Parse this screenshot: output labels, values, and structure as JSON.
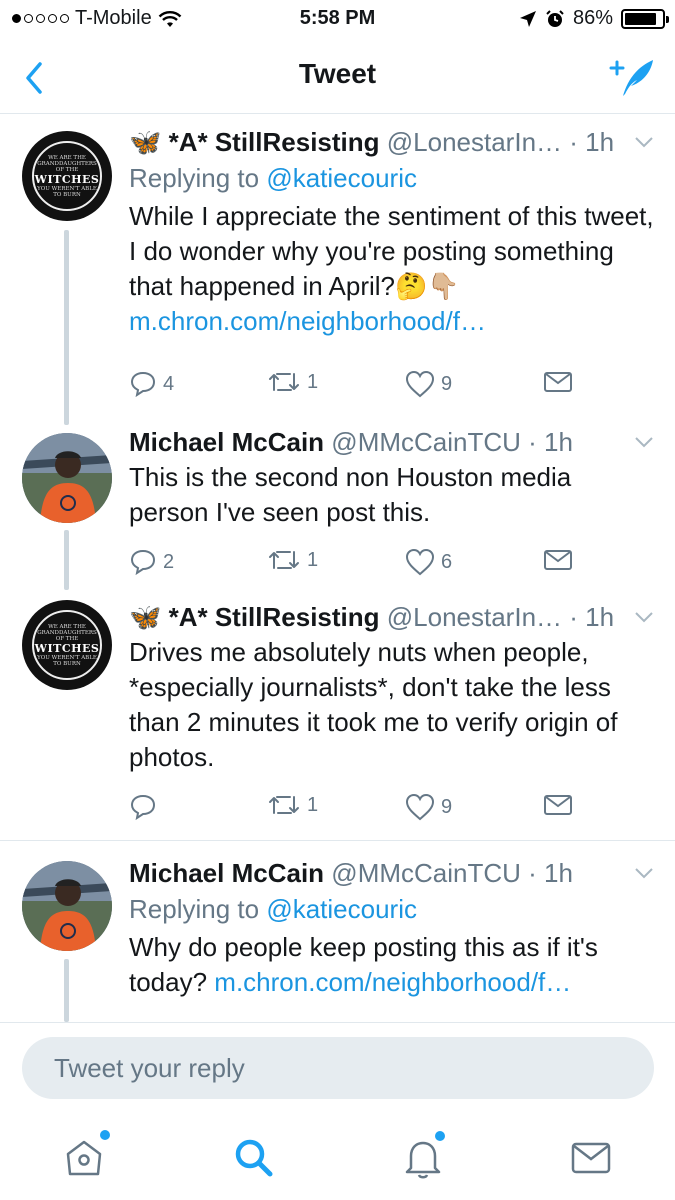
{
  "status_bar": {
    "carrier": "T-Mobile",
    "time": "5:58 PM",
    "battery": "86%",
    "battery_level": 0.86,
    "signal_bars_filled": 1,
    "signal_bars_total": 5
  },
  "nav": {
    "title": "Tweet",
    "back_icon": "chevron-left-icon",
    "compose_icon": "compose-tweet-icon",
    "accent_color": "#1da1f2"
  },
  "tweets": [
    {
      "name": "🦋 *A* StillResisting",
      "handle": "@LonestarIn…",
      "time": "· 1h",
      "replying_prefix": "Replying to ",
      "replying_to": "@katiecouric",
      "text": "While I appreciate the sentiment of this tweet, I do wonder why you're posting something that happened in April?🤔👇🏼",
      "link": "m.chron.com/neighborhood/f…",
      "replies": "4",
      "retweets": "1",
      "likes": "9",
      "avatar_lines": [
        "WE ARE THE",
        "GRANDDAUGHTERS",
        "OF THE",
        "WITCHES",
        "YOU WEREN'T ABLE",
        "TO BURN"
      ]
    },
    {
      "name": "Michael McCain",
      "handle": "@MMcCainTCU",
      "time": "· 1h",
      "text": "This is the second non Houston media person I've seen post this.",
      "replies": "2",
      "retweets": "1",
      "likes": "6"
    },
    {
      "name": "🦋 *A* StillResisting",
      "handle": "@LonestarIn…",
      "time": "· 1h",
      "text": "Drives me absolutely nuts when people, *especially journalists*, don't take the less than 2 minutes it took me to verify origin of photos.",
      "replies": "",
      "retweets": "1",
      "likes": "9",
      "avatar_lines": [
        "WE ARE THE",
        "GRANDDAUGHTERS",
        "OF THE",
        "WITCHES",
        "YOU WEREN'T ABLE",
        "TO BURN"
      ]
    },
    {
      "name": "Michael McCain",
      "handle": "@MMcCainTCU",
      "time": "· 1h",
      "replying_prefix": "Replying to ",
      "replying_to": "@katiecouric",
      "text": "Why do people keep posting this as if it's today? ",
      "link": "m.chron.com/neighborhood/f…"
    }
  ],
  "reply_bar": {
    "placeholder": "Tweet your reply"
  },
  "tab_bar": {
    "items": [
      "home-icon",
      "search-icon",
      "notifications-icon",
      "messages-icon"
    ],
    "active": "search-icon"
  }
}
